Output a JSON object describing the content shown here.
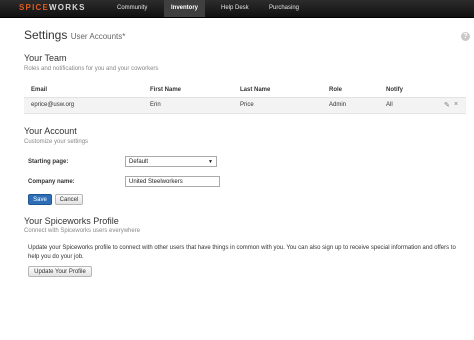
{
  "app": {
    "logo_part1": "SPICE",
    "logo_part2": "WORKS",
    "nav": [
      {
        "label": "Community",
        "active": false
      },
      {
        "label": "Inventory",
        "active": true
      },
      {
        "label": "Help Desk",
        "active": false
      },
      {
        "label": "Purchasing",
        "active": false
      }
    ]
  },
  "page": {
    "title": "Settings",
    "subtitle": "User Accounts*",
    "help_glyph": "?"
  },
  "team": {
    "heading": "Your Team",
    "description": "Roles and notifications for you and your coworkers",
    "columns": [
      "Email",
      "First Name",
      "Last Name",
      "Role",
      "Notify"
    ],
    "rows": [
      {
        "email": "eprice@usw.org",
        "first_name": "Erin",
        "last_name": "Price",
        "role": "Admin",
        "notify": "All"
      }
    ],
    "edit_glyph": "✎",
    "remove_glyph": "×"
  },
  "account": {
    "heading": "Your Account",
    "description": "Customize your settings",
    "starting_page_label": "Starting page:",
    "starting_page_value": "Default",
    "caret_glyph": "▼",
    "company_label": "Company name:",
    "company_value": "United Steelworkers",
    "save_label": "Save",
    "cancel_label": "Cancel"
  },
  "profile": {
    "heading": "Your Spiceworks Profile",
    "description": "Connect with Spiceworks users everywhere",
    "paragraph": "Update your Spiceworks profile to connect with other users that have things in common with you. You can also sign up to receive special information and offers to help you do your job.",
    "update_label": "Update Your Profile"
  },
  "colors": {
    "accent": "#2d6eb7",
    "brand_orange": "#e05a1e",
    "nav_bg": "#1a1a1a"
  }
}
